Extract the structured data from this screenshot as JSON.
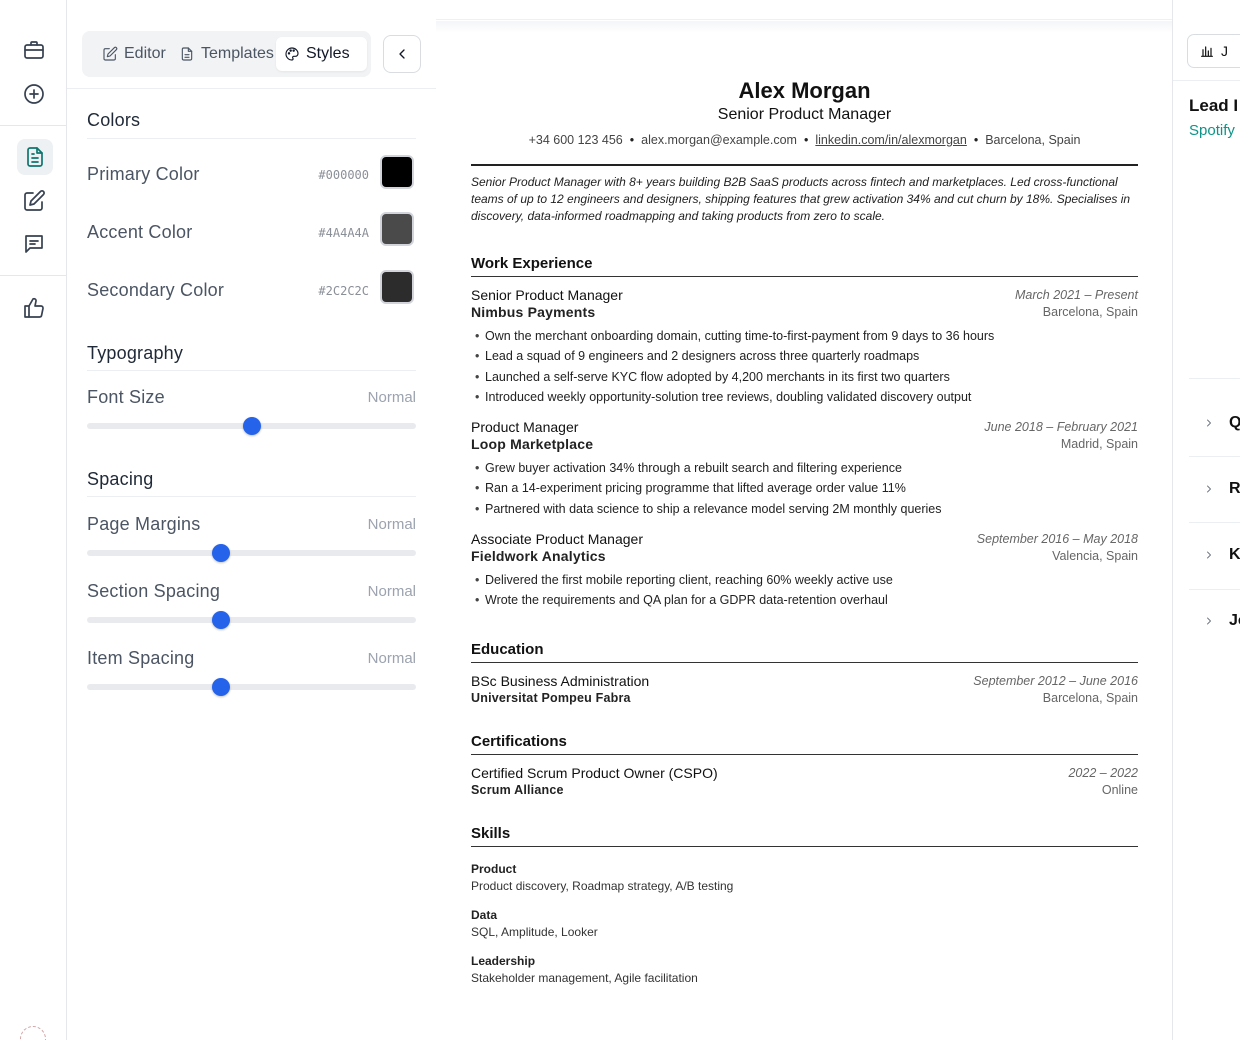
{
  "style_panel": {
    "tabs": [
      {
        "label": "Editor",
        "icon": "edit-icon"
      },
      {
        "label": "Templates",
        "icon": "document-icon"
      },
      {
        "label": "Styles",
        "icon": "palette-icon",
        "active": true
      }
    ],
    "colors": {
      "title": "Colors",
      "items": [
        {
          "label": "Primary Color",
          "hex": "#000000",
          "color": "#000000"
        },
        {
          "label": "Accent Color",
          "hex": "#4A4A4A",
          "color": "#4A4A4A"
        },
        {
          "label": "Secondary Color",
          "hex": "#2C2C2C",
          "color": "#2C2C2C"
        }
      ]
    },
    "typography": {
      "title": "Typography",
      "font_size": {
        "label": "Font Size",
        "value": "Normal",
        "fraction": 0.5
      }
    },
    "spacing": {
      "title": "Spacing",
      "items": [
        {
          "label": "Page Margins",
          "value": "Normal",
          "fraction": 0.407
        },
        {
          "label": "Section Spacing",
          "value": "Normal",
          "fraction": 0.407
        },
        {
          "label": "Item Spacing",
          "value": "Normal",
          "fraction": 0.407
        }
      ]
    }
  },
  "resume": {
    "name": "Alex Morgan",
    "title": "Senior Product Manager",
    "contact": {
      "phone": "+34 600 123 456",
      "email": "alex.morgan@example.com",
      "linkedin": "linkedin.com/in/alexmorgan",
      "location": "Barcelona, Spain"
    },
    "summary": "Senior Product Manager with 8+ years building B2B SaaS products across fintech and marketplaces. Led cross-functional teams of up to 12 engineers and designers, shipping features that grew activation 34% and cut churn by 18%. Specialises in discovery, data-informed roadmapping and taking products from zero to scale.",
    "work": {
      "heading": "Work Experience",
      "jobs": [
        {
          "role": "Senior Product Manager",
          "company": "Nimbus Payments",
          "dates": "March 2021 – Present",
          "location": "Barcelona, Spain",
          "bullets": [
            "Own the merchant onboarding domain, cutting time-to-first-payment from 9 days to 36 hours",
            "Lead a squad of 9 engineers and 2 designers across three quarterly roadmaps",
            "Launched a self-serve KYC flow adopted by 4,200 merchants in its first two quarters",
            "Introduced weekly opportunity-solution tree reviews, doubling validated discovery output"
          ]
        },
        {
          "role": "Product Manager",
          "company": "Loop Marketplace",
          "dates": "June 2018 – February 2021",
          "location": "Madrid, Spain",
          "bullets": [
            "Grew buyer activation 34% through a rebuilt search and filtering experience",
            "Ran a 14-experiment pricing programme that lifted average order value 11%",
            "Partnered with data science to ship a relevance model serving 2M monthly queries"
          ]
        },
        {
          "role": "Associate Product Manager",
          "company": "Fieldwork Analytics",
          "dates": "September 2016 – May 2018",
          "location": "Valencia, Spain",
          "bullets": [
            "Delivered the first mobile reporting client, reaching 60% weekly active use",
            "Wrote the requirements and QA plan for a GDPR data-retention overhaul"
          ]
        }
      ]
    },
    "education": {
      "heading": "Education",
      "degree": "BSc Business Administration",
      "school": "Universitat Pompeu Fabra",
      "dates": "September 2012 – June 2016",
      "location": "Barcelona, Spain"
    },
    "certifications": {
      "heading": "Certifications",
      "name": "Certified Scrum Product Owner (CSPO)",
      "issuer": "Scrum Alliance",
      "dates": "2022 – 2022",
      "location": "Online"
    },
    "skills": {
      "heading": "Skills",
      "groups": [
        {
          "category": "Product",
          "items": "Product discovery, Roadmap strategy, A/B testing"
        },
        {
          "category": "Data",
          "items": "SQL, Amplitude, Looker"
        },
        {
          "category": "Leadership",
          "items": "Stakeholder management, Agile facilitation"
        }
      ]
    }
  },
  "right_panel": {
    "button_label": "J",
    "title": "Lead I",
    "subtitle": "Spotify",
    "sections": [
      "Q",
      "R",
      "K",
      "Jo"
    ]
  },
  "colors": {
    "accent": "#2563eb",
    "brand": "#0d9488"
  }
}
